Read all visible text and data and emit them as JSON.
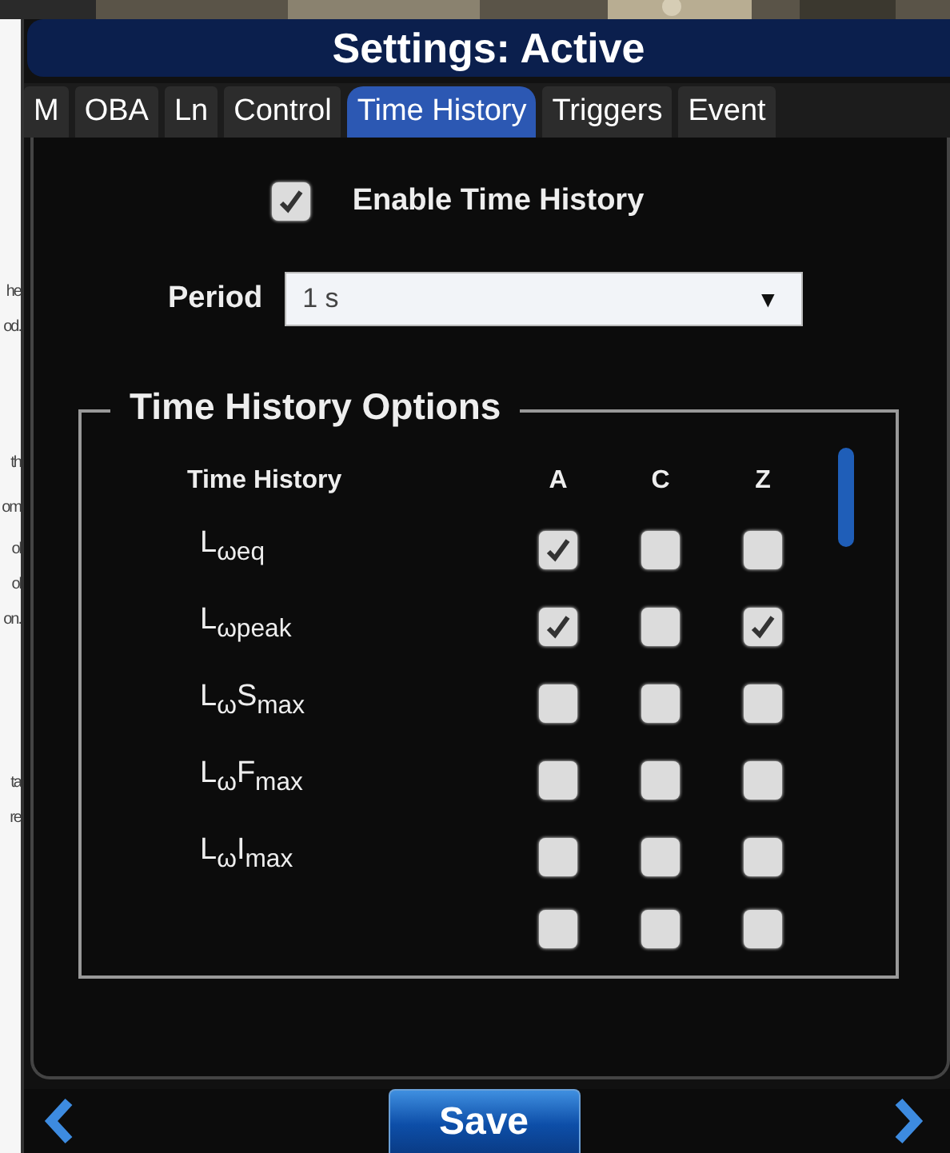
{
  "background_fragments": [
    "he",
    "od.",
    "th",
    "om",
    "ol",
    "ol",
    "on.",
    "ta",
    "re"
  ],
  "window": {
    "title": "Settings: Active"
  },
  "tabs": [
    {
      "label": "M",
      "selected": false
    },
    {
      "label": "OBA",
      "selected": false
    },
    {
      "label": "Ln",
      "selected": false
    },
    {
      "label": "Control",
      "selected": false
    },
    {
      "label": "Time History",
      "selected": true
    },
    {
      "label": "Triggers",
      "selected": false
    },
    {
      "label": "Event",
      "selected": false
    }
  ],
  "enable": {
    "label": "Enable Time History",
    "checked": true
  },
  "period": {
    "label": "Period",
    "value": "1 s",
    "arrow": "▼"
  },
  "options": {
    "legend": "Time History Options",
    "columns": [
      "Time History",
      "A",
      "C",
      "Z"
    ],
    "rows": [
      {
        "label": "L$_{ωeq}$",
        "checks": [
          true,
          false,
          false
        ]
      },
      {
        "label": "L$_{ωpeak}$",
        "checks": [
          true,
          false,
          true
        ]
      },
      {
        "label": "L$_{ω}$S$_{max}$",
        "checks": [
          false,
          false,
          false
        ]
      },
      {
        "label": "L$_{ω}$F$_{max}$",
        "checks": [
          false,
          false,
          false
        ]
      },
      {
        "label": "L$_{ω}$I$_{max}$",
        "checks": [
          false,
          false,
          false
        ]
      },
      {
        "checks": [
          false,
          false,
          false
        ]
      }
    ]
  },
  "footer": {
    "save": "Save"
  }
}
